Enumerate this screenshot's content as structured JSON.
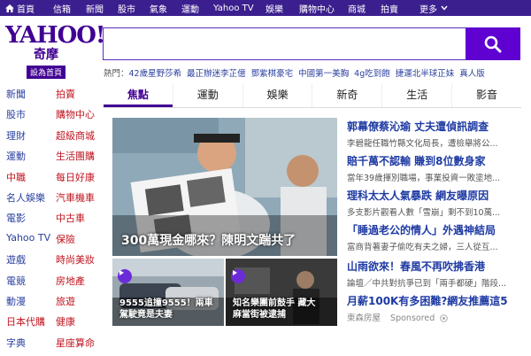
{
  "topnav": {
    "home": "首頁",
    "items": [
      "信箱",
      "新聞",
      "股市",
      "氣象",
      "運動",
      "Yahoo TV",
      "娛樂",
      "購物中心",
      "商城",
      "拍賣"
    ],
    "more": "更多"
  },
  "logo": {
    "brand": "YAHOO!",
    "cn": "奇摩",
    "home_button": "設為首頁"
  },
  "search": {
    "value": "",
    "placeholder": ""
  },
  "hot": {
    "label": "熱門：",
    "keywords": [
      "42歲星野莎希",
      "最正辦迷李芷億",
      "鄧紫棋豪宅",
      "中國第一美胸",
      "4g吃到飽",
      "捷運北半球正妹",
      "真人版"
    ]
  },
  "leftnav": {
    "items": [
      {
        "label": "新聞",
        "color": "#2a3f9f"
      },
      {
        "label": "拍賣",
        "color": "#c0141f"
      },
      {
        "label": "股市",
        "color": "#2a3f9f"
      },
      {
        "label": "購物中心",
        "color": "#c0141f"
      },
      {
        "label": "理財",
        "color": "#2a3f9f"
      },
      {
        "label": "超級商城",
        "color": "#c0141f"
      },
      {
        "label": "運動",
        "color": "#2a3f9f"
      },
      {
        "label": "生活團購",
        "color": "#c0141f"
      },
      {
        "label": "中職",
        "color": "#c0141f"
      },
      {
        "label": "每日好康",
        "color": "#c0141f"
      },
      {
        "label": "名人娛樂",
        "color": "#2a3f9f"
      },
      {
        "label": "汽車機車",
        "color": "#c0141f"
      },
      {
        "label": "電影",
        "color": "#2a3f9f"
      },
      {
        "label": "中古車",
        "color": "#c0141f"
      },
      {
        "label": "Yahoo TV",
        "color": "#2a3f9f"
      },
      {
        "label": "保險",
        "color": "#c0141f"
      },
      {
        "label": "遊戲",
        "color": "#2a3f9f"
      },
      {
        "label": "時尚美妝",
        "color": "#c0141f"
      },
      {
        "label": "電競",
        "color": "#2a3f9f"
      },
      {
        "label": "房地產",
        "color": "#c0141f"
      },
      {
        "label": "動漫",
        "color": "#2a3f9f"
      },
      {
        "label": "旅遊",
        "color": "#c0141f"
      },
      {
        "label": "日本代購",
        "color": "#c0141f"
      },
      {
        "label": "健康",
        "color": "#c0141f"
      },
      {
        "label": "字典",
        "color": "#2a3f9f"
      },
      {
        "label": "星座算命",
        "color": "#c0141f"
      }
    ]
  },
  "tabs": [
    "焦點",
    "運動",
    "娛樂",
    "新奇",
    "生活",
    "影音"
  ],
  "hero": {
    "caption": "300萬現金哪來？陳明文踹共了"
  },
  "thumbs": [
    {
      "caption_line1": "9555追撞9555！兩車",
      "caption_line2": "駕駛竟是夫妻"
    },
    {
      "caption_line1": "知名樂團前鼓手 藏大",
      "caption_line2": "麻當街被逮捕"
    }
  ],
  "headlines": [
    {
      "title": "郭幕僚蔡沁瑜 丈夫遭偵訊調查",
      "sub": "李碧龍任職竹縣文化局長，遭檢舉將公..."
    },
    {
      "title": "賠千萬不認輸 賺到8位數身家",
      "sub": "當年39歲揮別職場，事業投資一敗塗地..."
    },
    {
      "title": "理科太太人氣暴跌 網友曝原因",
      "sub": "多支影片觀看人數「雪崩」剩不到10萬..."
    },
    {
      "title": "「睡過老公的情人」外遇神結局",
      "sub": "富商背著妻子偷吃有夫之婦，三人從互..."
    },
    {
      "title": "山雨欲來！春風不再吹拂香港",
      "sub": "論壇／中共對抗爭已到「兩手都硬」階段..."
    },
    {
      "title": "月薪100K有多困難?網友推薦這5",
      "sub": "東森房屋",
      "sponsored": "Sponsored"
    }
  ],
  "colors": {
    "brand": "#410093",
    "topnav": "#3b1f8e",
    "search_button": "#5f01d1",
    "link": "#1e3aa3",
    "red": "#c0141f"
  }
}
